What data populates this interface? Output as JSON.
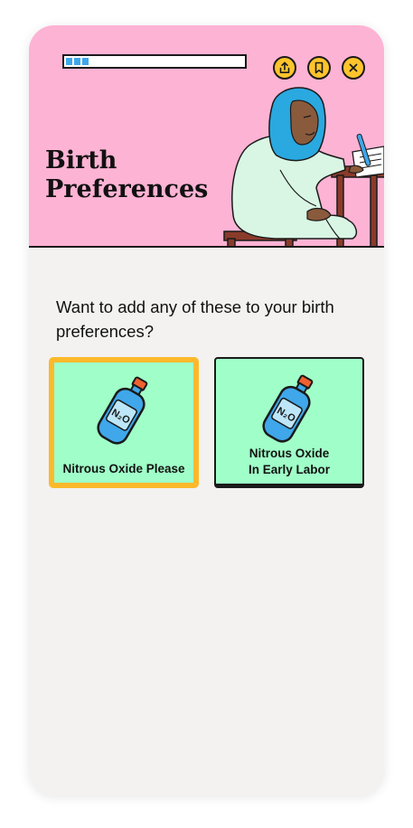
{
  "header": {
    "title_line1": "Birth",
    "title_line2": "Preferences",
    "progress_value": 0.13,
    "progress_segments": 3,
    "actions": [
      {
        "name": "share",
        "icon": "share-icon"
      },
      {
        "name": "bookmark",
        "icon": "bookmark-icon"
      },
      {
        "name": "close",
        "icon": "close-icon"
      }
    ],
    "illustration": "pregnant-woman-in-hijab-writing-at-desk"
  },
  "main": {
    "question": "Want to add any of these to your birth preferences?",
    "options": [
      {
        "line1": "Nitrous Oxide Please",
        "line2": "",
        "icon": "nitrous-oxide-bottle-icon",
        "selected": true
      },
      {
        "line1": "Nitrous Oxide",
        "line2": "In Early Labor",
        "icon": "nitrous-oxide-bottle-icon",
        "selected": false
      }
    ]
  },
  "colors": {
    "header_bg": "#fdb3d4",
    "page_bg": "#f3f2f1",
    "card_bg": "#a0ffc8",
    "selected_border": "#fcb92b",
    "button_bg": "#fec42c",
    "progress_fill": "#3fa7ea"
  }
}
